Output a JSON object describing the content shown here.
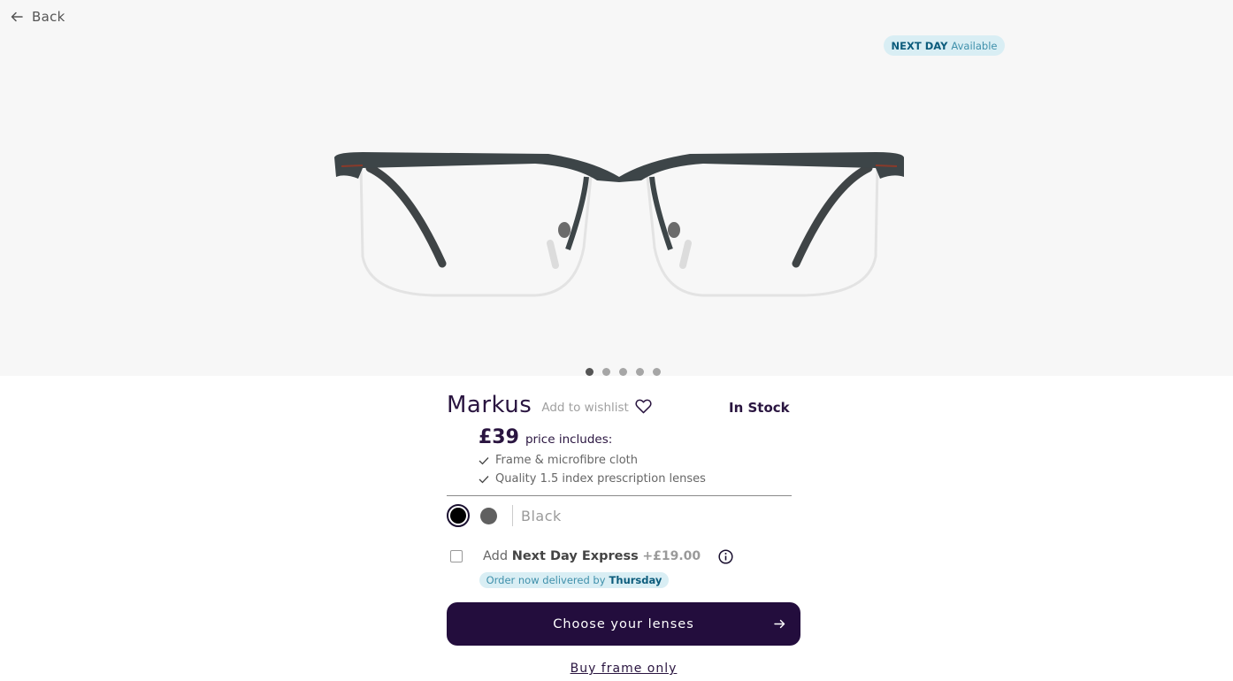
{
  "nav": {
    "back_label": "Back"
  },
  "badge": {
    "bold": "NEXT DAY",
    "text": "Available"
  },
  "carousel": {
    "count": 5,
    "active": 1
  },
  "product": {
    "name": "Markus",
    "wishlist_label": "Add to wishlist",
    "stock": "In Stock",
    "price": "£39",
    "price_includes": "price includes:",
    "features": [
      "Frame & microfibre cloth",
      "Quality 1.5 index prescription lenses"
    ]
  },
  "colors": {
    "selected_name": "Black",
    "options": [
      {
        "name": "Black",
        "hex": "#000000",
        "selected": true
      },
      {
        "name": "Grey",
        "hex": "#606060",
        "selected": false
      }
    ]
  },
  "express": {
    "prefix": "Add",
    "name": "Next Day Express",
    "price": "+£19.00",
    "checked": false,
    "delivery_text": "Order now delivered by",
    "delivery_day": "Thursday"
  },
  "actions": {
    "cta_label": "Choose your lenses",
    "frame_only_label": "Buy frame only"
  },
  "theme": {
    "primary": "#230d3d",
    "badge_bg": "#d9eef4",
    "badge_text": "#0c5c7c"
  }
}
